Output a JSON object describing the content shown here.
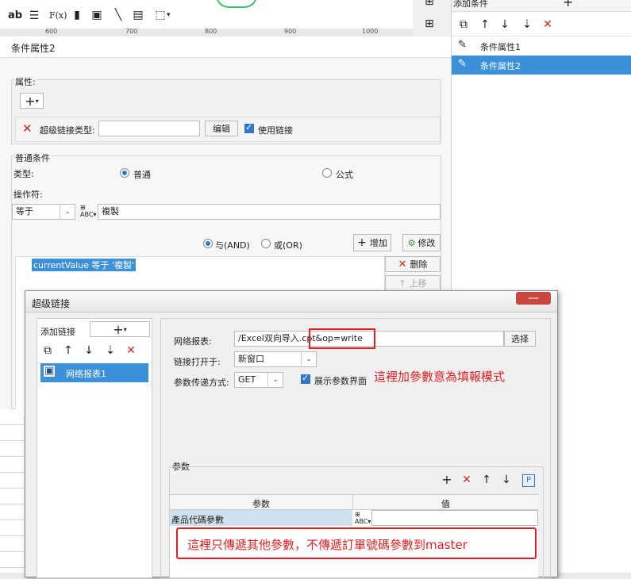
{
  "toolbar": {
    "items": [
      "ab",
      "F(x)"
    ]
  },
  "ruler": {
    "ticks": [
      "600",
      "700",
      "800",
      "900",
      "1000"
    ]
  },
  "side_panel": {
    "header": "添加条件",
    "add_icon": "plus-icon",
    "items": [
      "条件属性1",
      "条件属性2"
    ]
  },
  "condition_panel": {
    "title": "条件属性2",
    "attr_label": "属性:",
    "hyperlink_type_label": "超级链接类型:",
    "hyperlink_type_value": "",
    "edit_label": "编辑",
    "use_link_label": "使用链接",
    "normal_condition_label": "普通条件",
    "type_label": "类型:",
    "type_normal": "普通",
    "type_formula": "公式",
    "operator_label": "操作符:",
    "operator_value": "等于",
    "operand_value": "複製",
    "and_label": "与(AND)",
    "or_label": "或(OR)",
    "add_label": "增加",
    "modify_label": "修改",
    "delete_label": "删除",
    "move_up_label": "上移",
    "condition_text": "currentValue 等于 '複製'"
  },
  "dialog": {
    "title": "超级链接",
    "add_link_label": "添加链接",
    "link_item": "网络报表1",
    "report_label": "网络报表:",
    "report_value": "/Excel双向导入.cpt&op=write",
    "choose_label": "选择",
    "open_in_label": "链接打开于:",
    "open_in_value": "新窗口",
    "method_label": "参数传递方式:",
    "method_value": "GET",
    "show_param_label": "展示参数界面",
    "annotation1": "這裡加參數意為填報模式",
    "params_label": "参数",
    "col_param": "参数",
    "col_value": "值",
    "param_row_name": "產品代碼參數",
    "param_row_value": "",
    "annotation2": "這裡只傳遞其他參數，不傳遞訂單號碼參數到master"
  },
  "colors": {
    "accent": "#2f78c8",
    "selected_row": "#3c8fd9",
    "annotation_red": "#e02020",
    "delete_red": "#d32323"
  }
}
